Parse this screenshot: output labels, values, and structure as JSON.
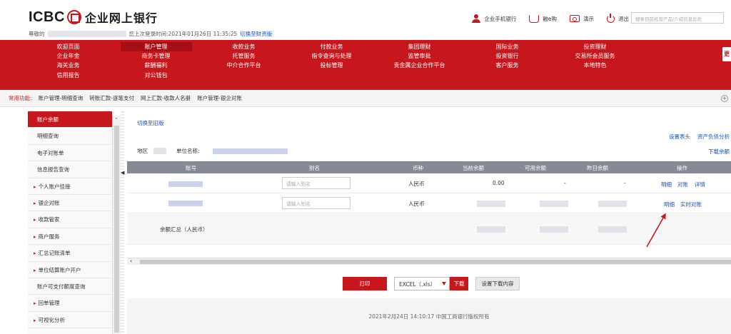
{
  "header": {
    "brand": "ICBC",
    "title": "企业网上银行",
    "greeting": "尊敬的",
    "last_login_label": "您上次登录时间:",
    "last_login_time": "2021年01月26日 11:35:25",
    "switch_label": "切换至财资版",
    "links": [
      "企业手机银行",
      "融e购",
      "演示",
      "退出"
    ],
    "search_placeholder": "搜索目前经营产品/介绍信息此处"
  },
  "nav": {
    "items": [
      "欢迎页面",
      "账户管理",
      "收款业务",
      "付款业务",
      "集团理财",
      "国际业务",
      "投资理财",
      "企业年金",
      "商务卡管理",
      "托管服务",
      "指令查询与处理",
      "监管审批",
      "投资银行",
      "交易所会员服务",
      "海关业务",
      "薪酬福利",
      "中介合作平台",
      "投标管理",
      "贵金属企业合作平台",
      "客户服务",
      "本地特色",
      "信用报告",
      "对公钱包"
    ],
    "active": "账户管理",
    "more_label": "更"
  },
  "common": {
    "label": "常用功能:",
    "items": [
      "账户管理-明细查询",
      "转账汇款-逐笔支付",
      "网上汇款-收款人名册",
      "账户管理-银企对账"
    ]
  },
  "sidebar": {
    "items": [
      {
        "label": "账户余额",
        "expandable": false,
        "active": true
      },
      {
        "label": "明细查询",
        "expandable": false,
        "active": false
      },
      {
        "label": "电子对账单",
        "expandable": false,
        "active": false
      },
      {
        "label": "信息报告查询",
        "expandable": false,
        "active": false
      },
      {
        "label": "个人账户挂接",
        "expandable": true,
        "active": false
      },
      {
        "label": "银企对账",
        "expandable": true,
        "active": false
      },
      {
        "label": "收款管家",
        "expandable": true,
        "active": false
      },
      {
        "label": "商户服务",
        "expandable": true,
        "active": false
      },
      {
        "label": "汇总记账清单",
        "expandable": true,
        "active": false
      },
      {
        "label": "单位结算账户开户",
        "expandable": true,
        "active": false
      },
      {
        "label": "账户可支付额度查询",
        "expandable": false,
        "active": false
      },
      {
        "label": "回单管理",
        "expandable": true,
        "active": false
      },
      {
        "label": "可视化分析",
        "expandable": true,
        "active": false
      }
    ]
  },
  "main": {
    "switch_old": "切换至旧版",
    "right_links": [
      "设置表头",
      "资产负债分析"
    ],
    "download_balance": "下载余额",
    "region_label": "地区",
    "unit_name_label": "单位名称:",
    "columns": [
      "账号",
      "别名",
      "币种",
      "当前余额",
      "可用余额",
      "昨日余额",
      "操作"
    ],
    "rows": [
      {
        "alias_placeholder": "请输入别名",
        "currency": "人民币",
        "current_balance": "0.00",
        "available_balance": "-",
        "yesterday_balance": "-",
        "ops": [
          "明细",
          "对账",
          "详情"
        ]
      },
      {
        "alias_placeholder": "请输入别名",
        "currency": "人民币",
        "current_balance": "",
        "available_balance": "",
        "yesterday_balance": "",
        "ops": [
          "明细",
          "实时对账"
        ]
      }
    ],
    "total_label": "余额汇总（人民币）",
    "print_label": "打印",
    "format_value": "EXCEL（.xls）",
    "download_label": "下载",
    "settings_label": "设置下载内容",
    "footer": "2021年2月24日 14:10:17    中国工商银行版权所有"
  },
  "colors": {
    "brand_red": "#c8161d",
    "link_blue": "#1a4fb3",
    "table_header": "#858a96"
  }
}
